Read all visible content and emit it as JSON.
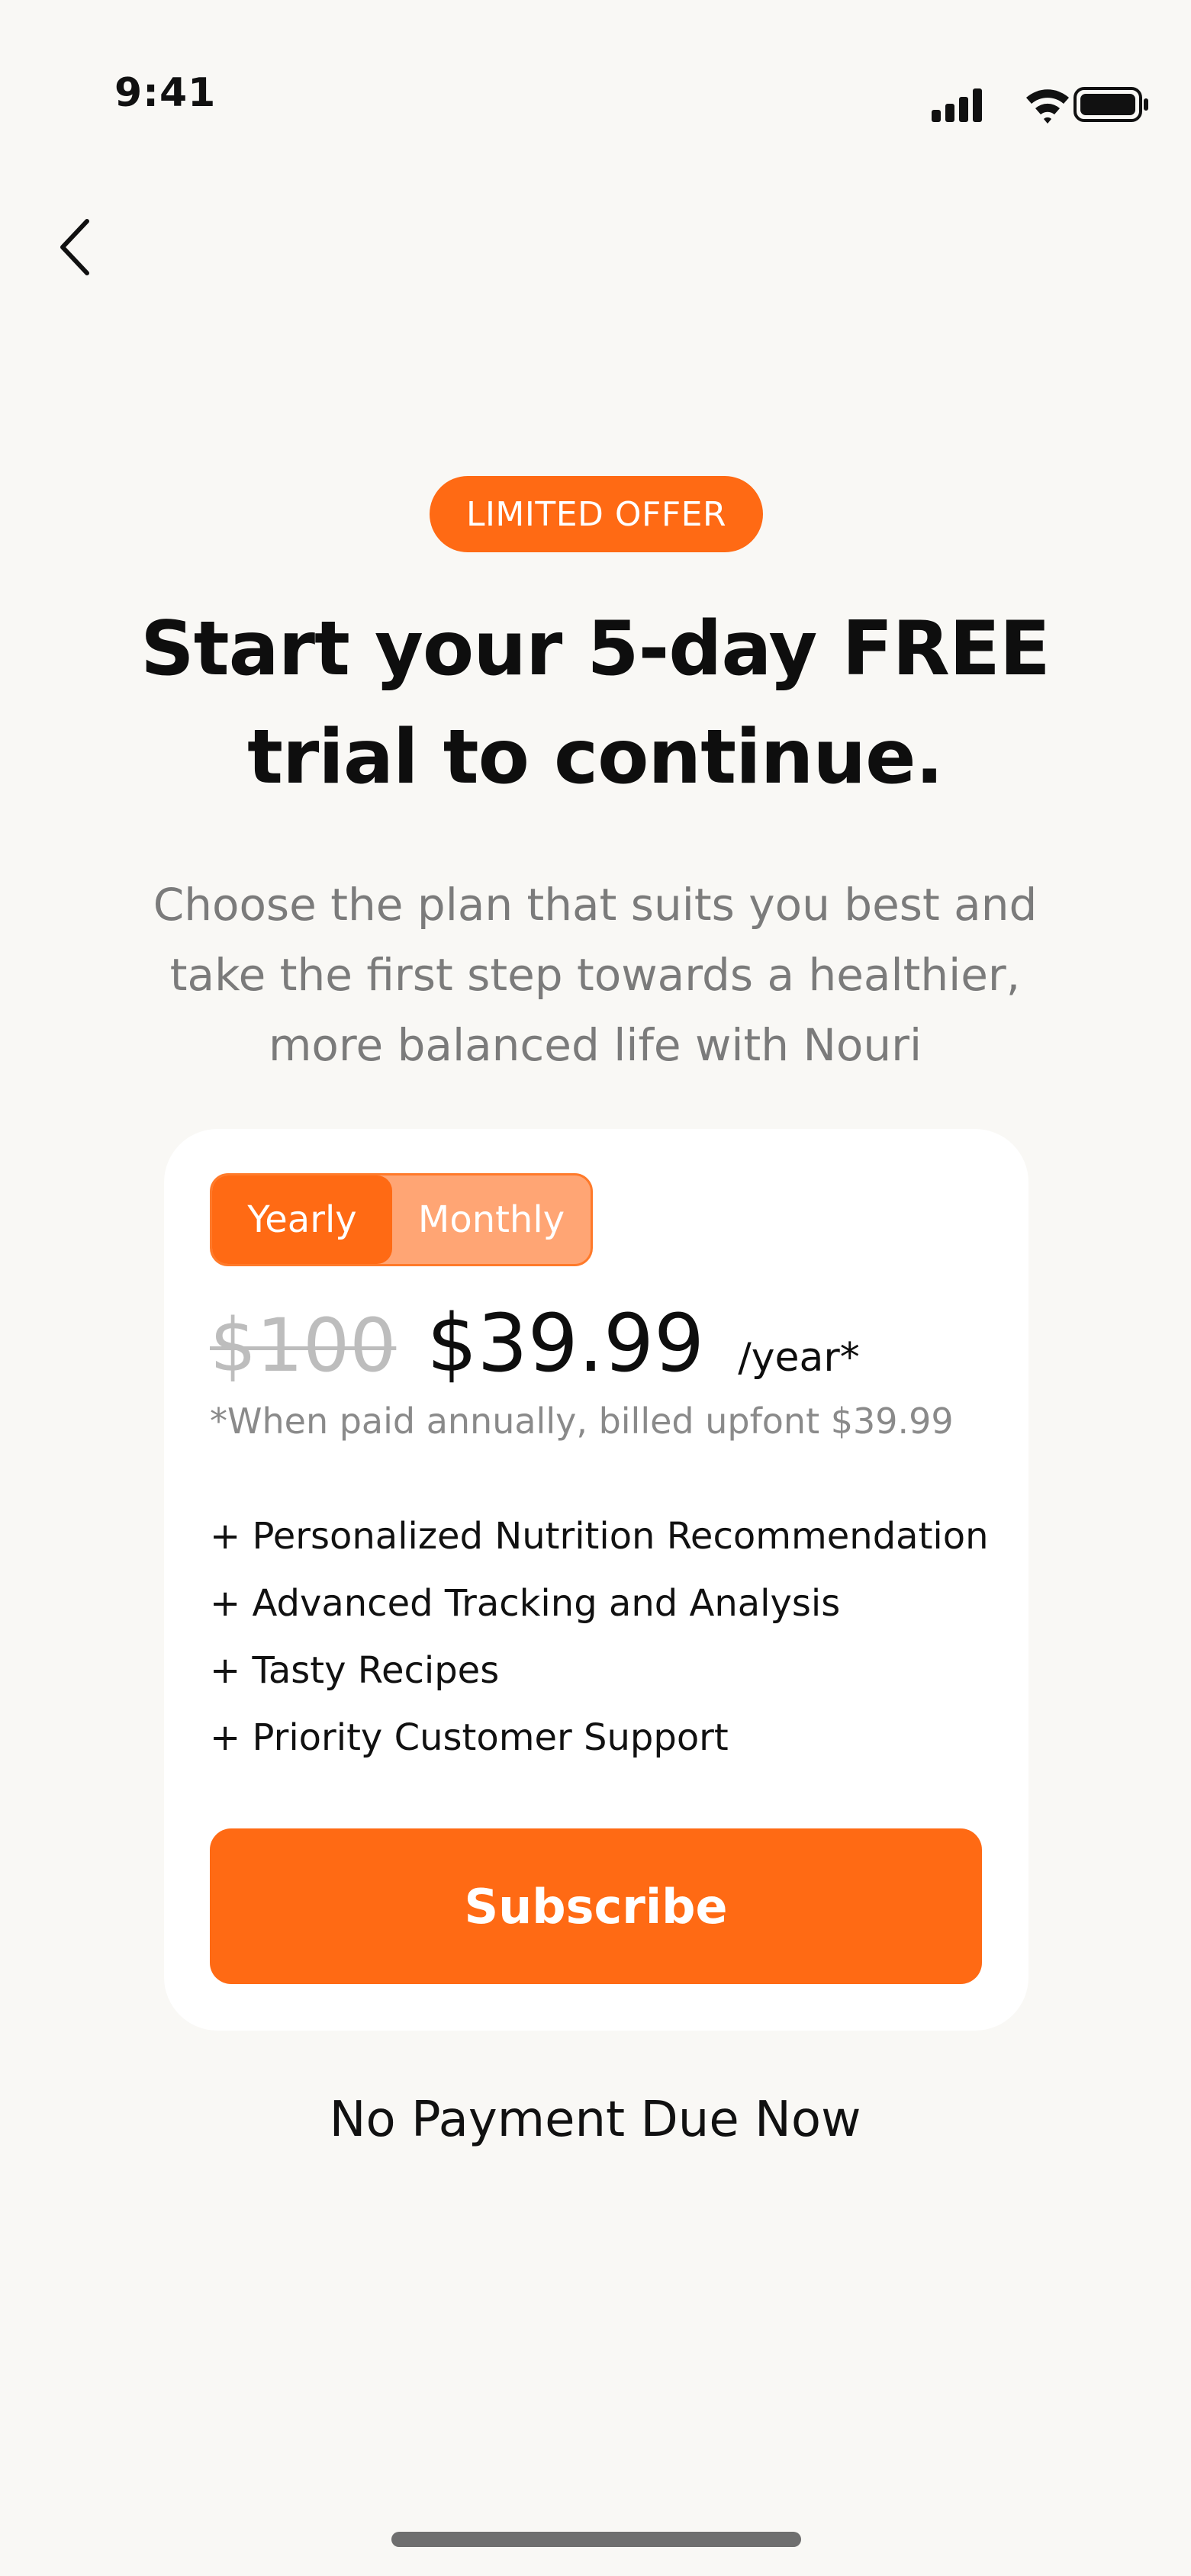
{
  "status_bar": {
    "time": "9:41",
    "icons": [
      "cellular-signal-icon",
      "wifi-icon",
      "battery-icon"
    ]
  },
  "nav": {
    "back_icon": "chevron-left-icon"
  },
  "badge": {
    "label": "LIMITED OFFER"
  },
  "headline": {
    "line1": "Start your 5-day FREE",
    "line2": "trial to continue."
  },
  "subtext": {
    "line1": "Choose the plan that suits you best and",
    "line2": "take the first step towards a healthier,",
    "line3": "more balanced life with Nouri"
  },
  "plan_card": {
    "toggle": {
      "options": [
        "Yearly",
        "Monthly"
      ],
      "selected": "Yearly"
    },
    "old_price": "$100",
    "price": "$39.99",
    "period": "/year*",
    "billing_note": "*When paid annually, billed upfont $39.99",
    "features": [
      "+ Personalized Nutrition Recommendation",
      "+ Advanced Tracking and Analysis",
      "+ Tasty Recipes",
      "+ Priority Customer Support"
    ],
    "subscribe_label": "Subscribe"
  },
  "footer": {
    "note": "No Payment Due Now"
  },
  "colors": {
    "accent": "#FF6A14",
    "accent_light": "#FFA574",
    "background": "#F9F8F5",
    "card": "#FFFFFF",
    "muted_text": "#7B7B7B"
  }
}
